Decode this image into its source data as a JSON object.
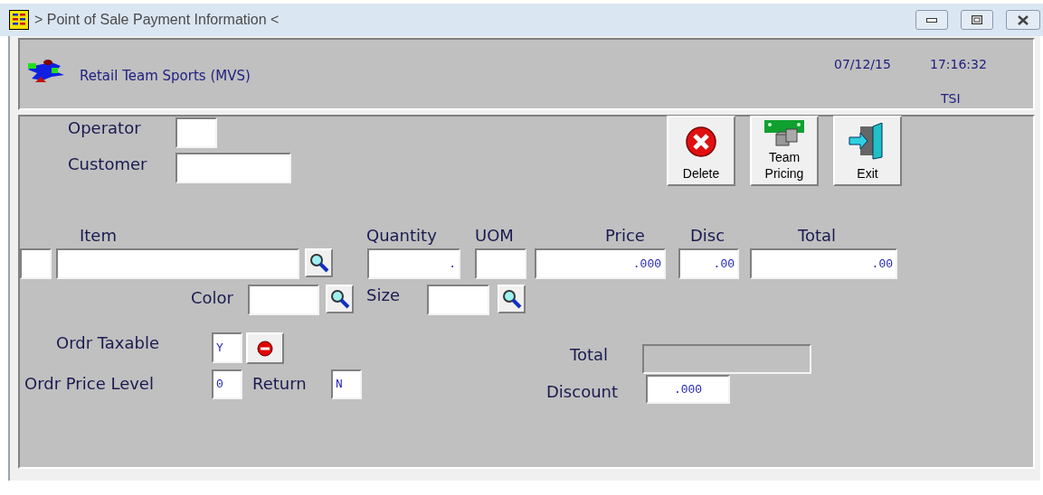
{
  "window": {
    "title": "> Point of Sale Payment Information <"
  },
  "header": {
    "company": "Retail Team Sports (MVS)",
    "date": "07/12/15",
    "time": "17:16:32",
    "user": "TSI"
  },
  "toolbar": [
    {
      "kind": "delete",
      "label": "Delete"
    },
    {
      "kind": "team_pricing",
      "label": "Team Pricing"
    },
    {
      "kind": "exit",
      "label": "Exit"
    }
  ],
  "fields": [
    {
      "label": "Operator",
      "kind": "plain",
      "disabled": false
    },
    {
      "label": "Customer",
      "kind": "plain",
      "disabled": false
    },
    {
      "kind": "plain",
      "disabled": false
    },
    {
      "label": "Item",
      "kind": "lookup",
      "disabled": false
    },
    {
      "label": "Quantity",
      "value": ".",
      "kind": "plain",
      "disabled": false
    },
    {
      "label": "UOM",
      "kind": "plain",
      "disabled": false
    },
    {
      "label": "Price",
      "value": ".000",
      "kind": "plain",
      "disabled": false
    },
    {
      "label": "Disc",
      "value": ".00",
      "kind": "plain",
      "disabled": false
    },
    {
      "label": "Total",
      "value": ".00",
      "kind": "plain",
      "disabled": false
    },
    {
      "label": "Color",
      "kind": "lookup",
      "disabled": false
    },
    {
      "label": "Size",
      "kind": "lookup",
      "disabled": false
    },
    {
      "label": "Ordr Taxable",
      "value": "Y",
      "kind": "clear",
      "disabled": false
    },
    {
      "label": "Ordr Price Level",
      "value": "0",
      "kind": "plain",
      "disabled": false
    },
    {
      "label": "Return",
      "value": "N",
      "kind": "plain",
      "disabled": false
    },
    {
      "label": "Total",
      "kind": "plain",
      "disabled": true
    },
    {
      "label": "Discount",
      "value": ".000",
      "kind": "plain",
      "disabled": false
    }
  ]
}
